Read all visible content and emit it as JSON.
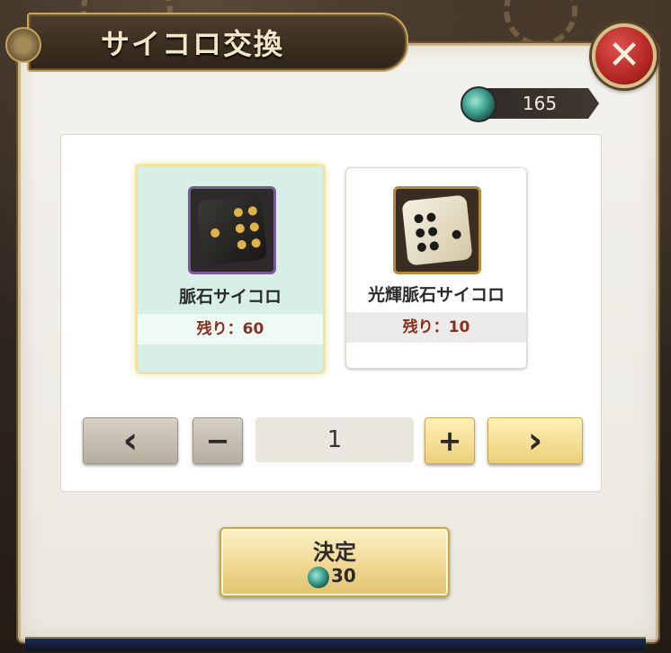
{
  "header": {
    "title": "サイコロ交換",
    "close_icon": "close-x-icon",
    "close_label": "✕"
  },
  "currency": {
    "icon": "spirit-orb-icon",
    "value": "165"
  },
  "dice": [
    {
      "name": "脈石サイコロ",
      "remaining": "残り：60",
      "selected": true,
      "icon": "dark-stone-dice-icon"
    },
    {
      "name": "光輝脈石サイコロ",
      "remaining": "残り：10",
      "selected": false,
      "icon": "shining-stone-dice-icon"
    }
  ],
  "stepper": {
    "prev_label": "‹",
    "minus_label": "−",
    "quantity": "1",
    "plus_label": "+",
    "next_label": "›"
  },
  "confirm": {
    "label": "決定",
    "cost_icon": "spirit-orb-icon",
    "cost": "30"
  },
  "colors": {
    "selected_card_bg": "#d7efe6",
    "remaining_text": "#8a2e1e",
    "close_button": "#b22724",
    "gold_button": "#ecd07a"
  }
}
